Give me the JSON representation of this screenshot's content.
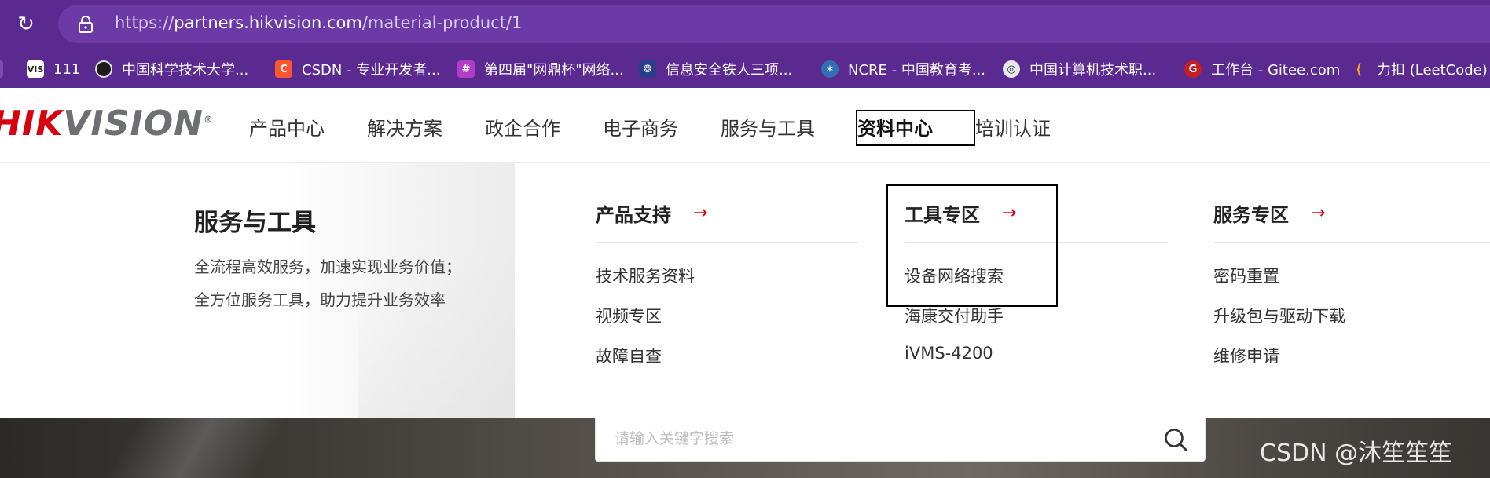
{
  "browser": {
    "url_prefix": "https://",
    "url_host": "partners.hikvision.com",
    "url_path": "/material-product/1",
    "bookmarks": [
      {
        "label": "111",
        "icon": "vis-icon"
      },
      {
        "label": "中国科学技术大学...",
        "icon": "ustc-icon"
      },
      {
        "label": "CSDN - 专业开发者...",
        "icon": "csdn-icon"
      },
      {
        "label": "第四届\"网鼎杯\"网络...",
        "icon": "wdb-icon"
      },
      {
        "label": "信息安全铁人三项...",
        "icon": "shield-icon"
      },
      {
        "label": "NCRE - 中国教育考...",
        "icon": "ncre-icon"
      },
      {
        "label": "中国计算机技术职...",
        "icon": "ccf-icon"
      },
      {
        "label": "工作台 - Gitee.com",
        "icon": "gitee-icon"
      },
      {
        "label": "力扣 (LeetCode) 全",
        "icon": "leetcode-icon"
      }
    ]
  },
  "site": {
    "logo_red": "HIK",
    "logo_grey": "VISION",
    "nav": [
      "产品中心",
      "解决方案",
      "政企合作",
      "电子商务",
      "服务与工具",
      "资料中心",
      "培训认证"
    ],
    "active_nav_index": 5,
    "accent_color": "#d7000f"
  },
  "dropdown": {
    "title": "服务与工具",
    "desc_line1": "全流程高效服务，加速实现业务价值；",
    "desc_line2": "全方位服务工具，助力提升业务效率",
    "columns": [
      {
        "heading": "产品支持",
        "links": [
          "技术服务资料",
          "视频专区",
          "故障自查"
        ]
      },
      {
        "heading": "工具专区",
        "links": [
          "设备网络搜索",
          "海康交付助手",
          "iVMS-4200"
        ]
      },
      {
        "heading": "服务专区",
        "links": [
          "密码重置",
          "升级包与驱动下载",
          "维修申请"
        ]
      }
    ],
    "arrow_glyph": "→"
  },
  "search": {
    "placeholder": "请输入关键字搜索"
  },
  "watermark": "CSDN @沐笙笙笙"
}
